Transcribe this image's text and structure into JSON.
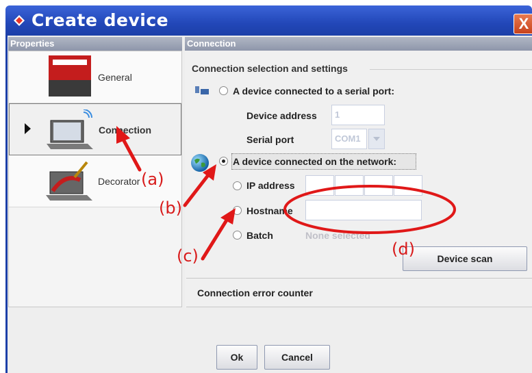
{
  "window": {
    "title": "Create device",
    "close_label": "X",
    "colors": {
      "titlebar": "#2247b8",
      "accent_red": "#d81b1b"
    }
  },
  "properties": {
    "header": "Properties",
    "items": [
      {
        "label": "General",
        "icon": "barco-logo-icon"
      },
      {
        "label": "Connection",
        "icon": "laptop-wireless-icon",
        "selected": true
      },
      {
        "label": "Decorator",
        "icon": "laptop-paint-icon"
      }
    ]
  },
  "connection": {
    "header": "Connection",
    "section_title": "Connection selection and settings",
    "serial": {
      "label": "A device connected to a serial port:",
      "device_address_label": "Device address",
      "device_address_value": "1",
      "serial_port_label": "Serial port",
      "serial_port_value": "COM1"
    },
    "network": {
      "label": "A device connected on the network:",
      "ip_label": "IP address",
      "hostname_label": "Hostname",
      "batch_label": "Batch",
      "batch_value": "None selected",
      "device_scan_label": "Device scan"
    },
    "error_counter_label": "Connection error counter"
  },
  "footer": {
    "ok_label": "Ok",
    "cancel_label": "Cancel"
  },
  "annotations": {
    "a": "(a)",
    "b": "(b)",
    "c": "(c)",
    "d": "(d)"
  }
}
